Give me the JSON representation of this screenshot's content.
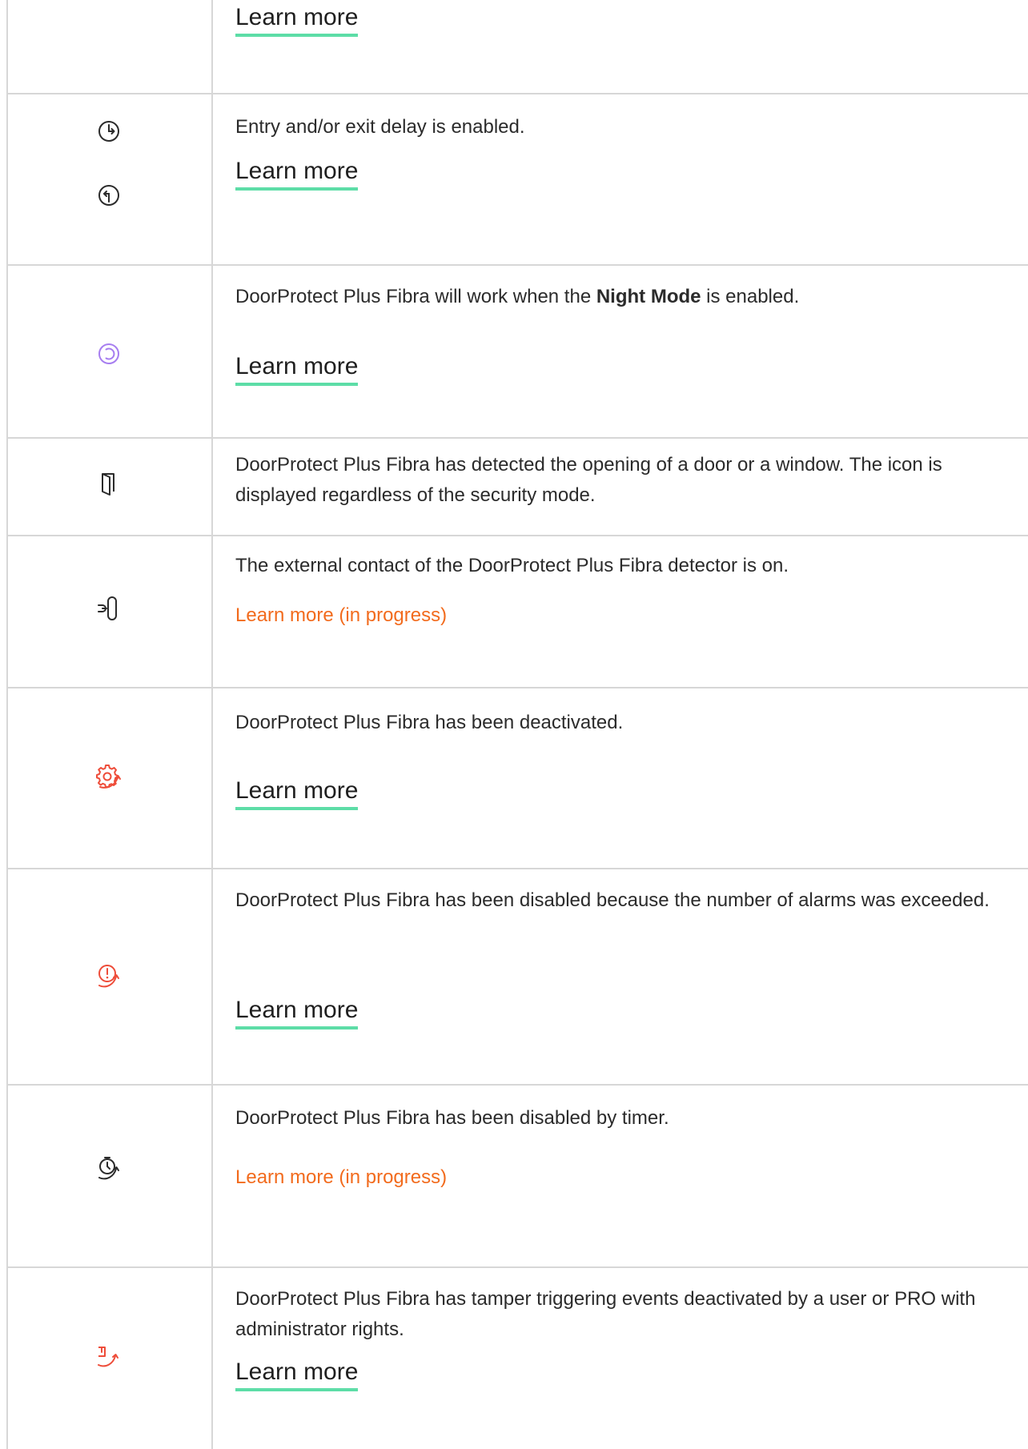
{
  "rows": [
    {
      "link": "Learn more"
    },
    {
      "icons": [
        "entry-delay-icon",
        "exit-delay-icon"
      ],
      "description": "Entry and/or exit delay is enabled.",
      "link": "Learn more"
    },
    {
      "icons": [
        "night-mode-icon"
      ],
      "description_pre": "DoorProtect Plus Fibra will work when the ",
      "description_bold": "Night Mode",
      "description_post": " is enabled.",
      "link": "Learn more"
    },
    {
      "icons": [
        "open-door-icon"
      ],
      "description": "DoorProtect Plus Fibra has detected the opening of a door or a window. The icon is displayed regardless of the security mode."
    },
    {
      "icons": [
        "external-contact-icon"
      ],
      "description": "The external contact of the DoorProtect Plus Fibra detector is on.",
      "link": "Learn more (in progress)"
    },
    {
      "icons": [
        "deactivated-gear-icon"
      ],
      "description": "DoorProtect Plus Fibra has been deactivated.",
      "link": "Learn more"
    },
    {
      "icons": [
        "alarm-limit-icon"
      ],
      "description": "DoorProtect Plus Fibra has been disabled because the number of alarms was exceeded.",
      "link": "Learn more"
    },
    {
      "icons": [
        "timer-disabled-icon"
      ],
      "description": "DoorProtect Plus Fibra has been disabled by timer.",
      "link": "Learn more (in progress)"
    },
    {
      "icons": [
        "tamper-disabled-icon"
      ],
      "description": "DoorProtect Plus Fibra has tamper triggering events deactivated by a user or PRO with administrator rights.",
      "link": "Learn more"
    }
  ],
  "colors": {
    "border": "#d7d7d7",
    "link_underline": "#5ddda7",
    "in_progress_link": "#f26b1d",
    "night_mode_icon": "#a77ef0",
    "warning_icon": "#ee4d3a",
    "neutral_icon": "#2b2b2b"
  }
}
